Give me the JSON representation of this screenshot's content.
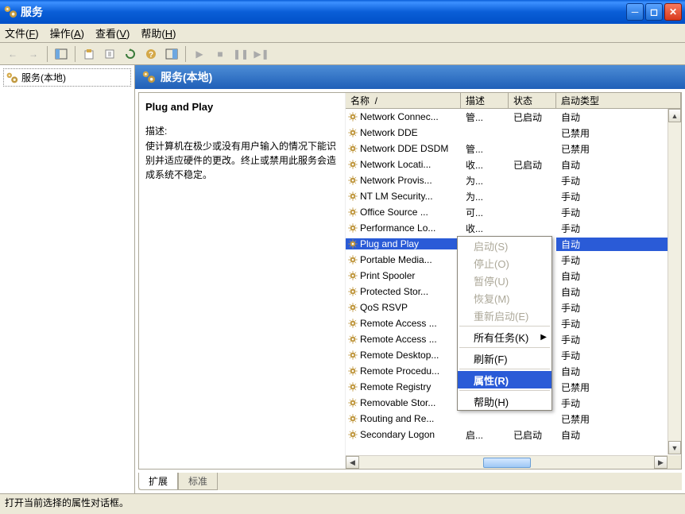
{
  "window": {
    "title": "服务"
  },
  "menu": {
    "file": "文件(F)",
    "action": "操作(A)",
    "view": "查看(V)",
    "help": "帮助(H)"
  },
  "tree": {
    "root": "服务(本地)"
  },
  "header": {
    "title": "服务(本地)"
  },
  "detail": {
    "name": "Plug and Play",
    "descLabel": "描述:",
    "desc": "使计算机在极少或没有用户输入的情况下能识别并适应硬件的更改。终止或禁用此服务会造成系统不稳定。"
  },
  "columns": {
    "name": "名称",
    "desc": "描述",
    "status": "状态",
    "start": "启动类型"
  },
  "services": [
    {
      "name": "Network Connec...",
      "desc": "管...",
      "status": "已启动",
      "start": "自动"
    },
    {
      "name": "Network DDE",
      "desc": "",
      "status": "",
      "start": "已禁用"
    },
    {
      "name": "Network DDE DSDM",
      "desc": "管...",
      "status": "",
      "start": "已禁用"
    },
    {
      "name": "Network Locati...",
      "desc": "收...",
      "status": "已启动",
      "start": "自动"
    },
    {
      "name": "Network Provis...",
      "desc": "为...",
      "status": "",
      "start": "手动"
    },
    {
      "name": "NT LM Security...",
      "desc": "为...",
      "status": "",
      "start": "手动"
    },
    {
      "name": "Office Source ...",
      "desc": "可...",
      "status": "",
      "start": "手动"
    },
    {
      "name": "Performance Lo...",
      "desc": "收...",
      "status": "",
      "start": "手动"
    },
    {
      "name": "Plug and Play",
      "desc": "",
      "status": "",
      "start": "自动",
      "selected": true
    },
    {
      "name": "Portable Media...",
      "desc": "",
      "status": "",
      "start": "手动"
    },
    {
      "name": "Print Spooler",
      "desc": "",
      "status": "",
      "start": "自动"
    },
    {
      "name": "Protected Stor...",
      "desc": "",
      "status": "",
      "start": "自动"
    },
    {
      "name": "QoS RSVP",
      "desc": "",
      "status": "",
      "start": "手动"
    },
    {
      "name": "Remote Access ...",
      "desc": "",
      "status": "",
      "start": "手动"
    },
    {
      "name": "Remote Access ...",
      "desc": "",
      "status": "",
      "start": "手动"
    },
    {
      "name": "Remote Desktop...",
      "desc": "",
      "status": "",
      "start": "手动"
    },
    {
      "name": "Remote Procedu...",
      "desc": "",
      "status": "",
      "start": "自动"
    },
    {
      "name": "Remote Registry",
      "desc": "",
      "status": "",
      "start": "已禁用"
    },
    {
      "name": "Removable Stor...",
      "desc": "",
      "status": "",
      "start": "手动"
    },
    {
      "name": "Routing and Re...",
      "desc": "",
      "status": "",
      "start": "已禁用"
    },
    {
      "name": "Secondary Logon",
      "desc": "启...",
      "status": "已启动",
      "start": "自动"
    }
  ],
  "context": {
    "start": "启动(S)",
    "stop": "停止(O)",
    "pause": "暂停(U)",
    "resume": "恢复(M)",
    "restart": "重新启动(E)",
    "alltasks": "所有任务(K)",
    "refresh": "刷新(F)",
    "properties": "属性(R)",
    "help": "帮助(H)"
  },
  "tabs": {
    "extended": "扩展",
    "standard": "标准"
  },
  "statusbar": "打开当前选择的属性对话框。"
}
